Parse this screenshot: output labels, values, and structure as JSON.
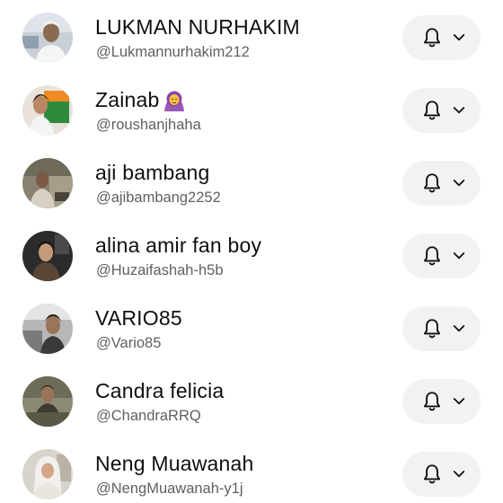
{
  "subscriptions": [
    {
      "name": "LUKMAN NURHAKIM",
      "handle": "@Lukmannurhakim212",
      "avatar_bg": "#c9cfd6",
      "emoji": ""
    },
    {
      "name": "Zainab",
      "handle": "@roushanjhaha",
      "avatar_bg": "#e9e2da",
      "emoji": "woman-with-headscarf-emoji"
    },
    {
      "name": "aji bambang",
      "handle": "@ajibambang2252",
      "avatar_bg": "#8a8270",
      "emoji": ""
    },
    {
      "name": "alina amir fan boy",
      "handle": "@Huzaifashah-h5b",
      "avatar_bg": "#2b2b2b",
      "emoji": ""
    },
    {
      "name": "VARIO85",
      "handle": "@Vario85",
      "avatar_bg": "#b7b7b7",
      "emoji": ""
    },
    {
      "name": "Candra felicia",
      "handle": "@ChandraRRQ",
      "avatar_bg": "#8d8a73",
      "emoji": ""
    },
    {
      "name": "Neng Muawanah",
      "handle": "@NengMuawanah-y1j",
      "avatar_bg": "#d8d4cc",
      "emoji": ""
    }
  ],
  "icons": {
    "notification": "bell-icon",
    "dropdown": "chevron-down-icon"
  }
}
